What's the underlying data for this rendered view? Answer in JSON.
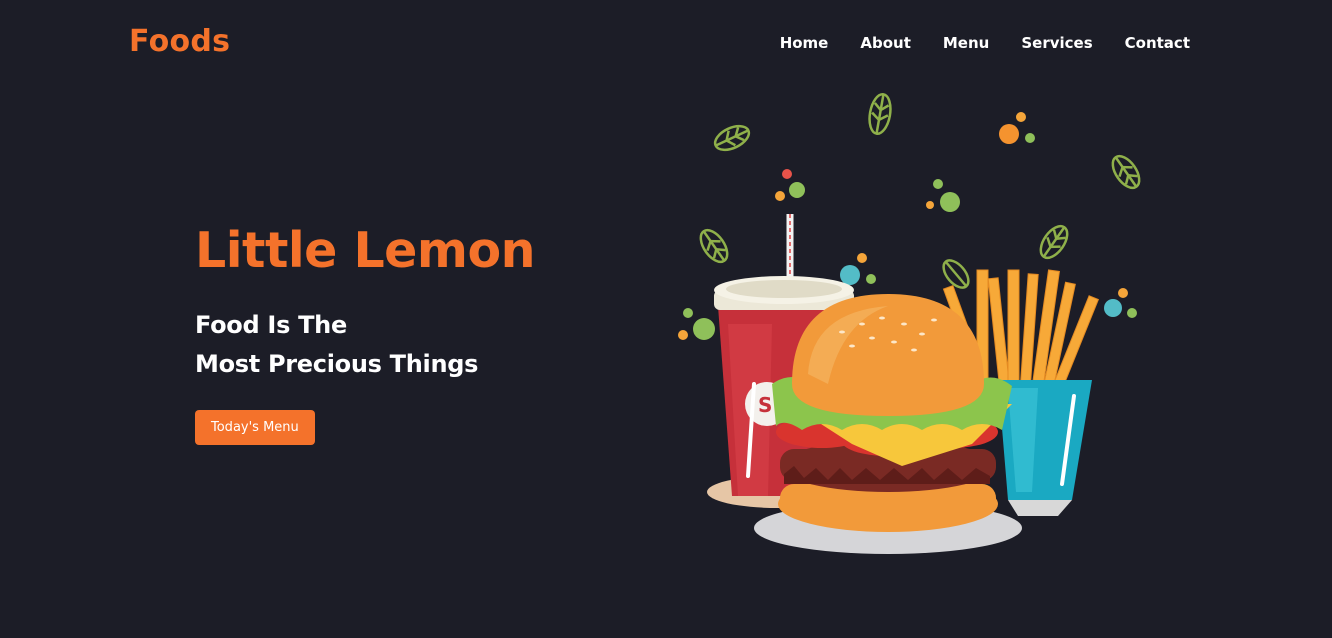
{
  "brand": {
    "logo": "Foods",
    "accent": "#f4722b",
    "background": "#1c1d27"
  },
  "nav": {
    "items": [
      "Home",
      "About",
      "Menu",
      "Services",
      "Contact"
    ]
  },
  "hero": {
    "title": "Little Lemon",
    "subtitle_line1": "Food Is The",
    "subtitle_line2": "Most Precious Things",
    "cta_label": "Today's Menu"
  },
  "illustration": {
    "icons": [
      "drink-cup-icon",
      "burger-icon",
      "fries-icon",
      "leaf-icon"
    ]
  }
}
